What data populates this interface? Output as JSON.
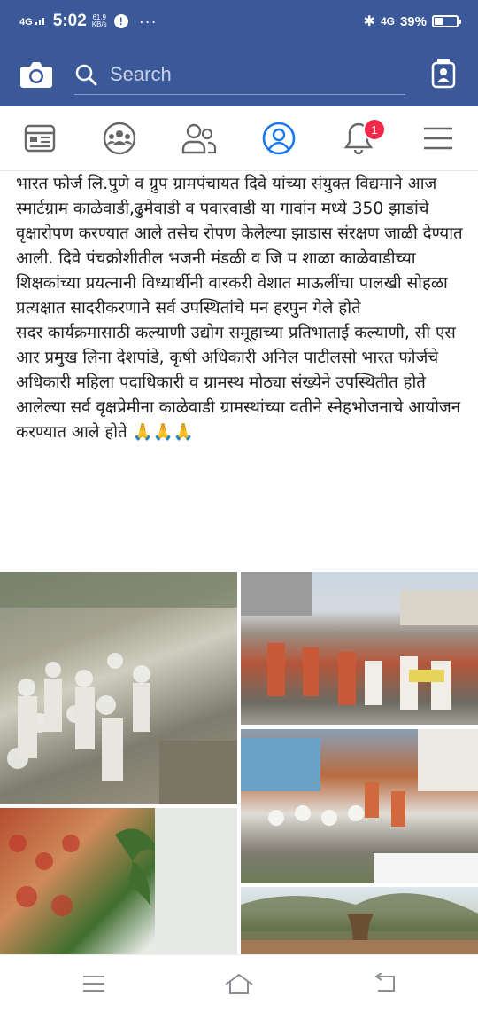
{
  "status_bar": {
    "network_left": "4G",
    "time": "5:02",
    "speed_value": "61.9",
    "speed_unit": "KB/s",
    "alert_glyph": "!",
    "more_glyph": "···",
    "bluetooth_glyph": "✱",
    "network_right": "4G",
    "battery_percent": "39%",
    "battery_level": 0.39
  },
  "search": {
    "placeholder": "Search"
  },
  "tabs": [
    {
      "name": "news-feed",
      "icon": "newsfeed-icon"
    },
    {
      "name": "groups",
      "icon": "groups-icon"
    },
    {
      "name": "friends",
      "icon": "friends-icon"
    },
    {
      "name": "profile",
      "icon": "profile-icon",
      "active": true
    },
    {
      "name": "notifications",
      "icon": "bell-icon",
      "badge": "1"
    },
    {
      "name": "menu",
      "icon": "hamburger-icon"
    }
  ],
  "post": {
    "paragraph1": "भारत फोर्ज लि.पुणे व ग्रुप ग्रामपंचायत दिवे यांच्या संयुक्त विद्यमाने आज स्मार्टग्राम काळेवाडी,ढुमेवाडी व पवारवाडी या गावांन मध्ये 350 झाडांचे वृक्षारोपण करण्यात आले तसेच रोपण केलेल्या झाडास संरक्षण जाळी देण्यात आली. दिवे पंचक्रोशीतील भजनी मंडळी व जि प शाळा काळेवाडीच्या शिक्षकांच्या प्रयत्नानी विध्यार्थीनी वारकरी वेशात माऊलींचा पालखी सोहळा प्रत्यक्षात सादरीकरणाने सर्व उपस्थितांचे मन हरपुन गेले होते",
    "paragraph2": "सदर कार्यक्रमासाठी कल्याणी उद्योग समूहाच्या प्रतिभाताई कल्याणी, सी एस आर प्रमुख लिना देशपांडे, कृषी अधिकारी अनिल पाटीलसो भारत फोर्जचे अधिकारी महिला पदाधिकारी व ग्रामस्थ मोठ्या संख्येने उपस्थितीत होते आलेल्या सर्व वृक्षप्रेमीना काळेवाडी ग्रामस्थांच्या वतीने स्नेहभोजनाचे आयोजन करण्यात आले होते",
    "emoji": "🙏🙏🙏"
  },
  "colors": {
    "brand": "#3b5998",
    "active_tab": "#1877f2",
    "badge": "#f02849"
  }
}
